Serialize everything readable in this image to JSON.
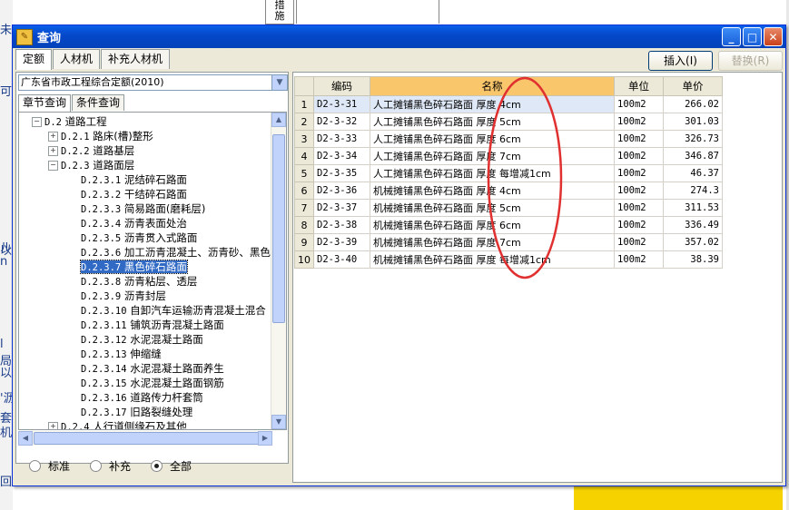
{
  "background": {
    "left_fragments": [
      "未",
      "可",
      "以",
      "ルn",
      "l局",
      "以",
      "'沥",
      "套",
      "机",
      "回"
    ],
    "top_cell_text": "措\n施"
  },
  "dialog": {
    "title": "查询",
    "title_icon": "query-icon",
    "window_buttons": {
      "minimize": "_",
      "maximize": "□",
      "close": "✕"
    },
    "tabs": [
      "定额",
      "人材机",
      "补充人材机"
    ],
    "active_tab": "定额",
    "insert_button": "插入(I)",
    "replace_button": "替换(R)"
  },
  "left": {
    "quota_book": "广东省市政工程综合定额(2010)",
    "subtabs": [
      "章节查询",
      "条件查询"
    ],
    "tree": [
      {
        "level": 0,
        "toggle": "−",
        "code": "D.2",
        "label": "道路工程"
      },
      {
        "level": 1,
        "toggle": "+",
        "code": "D.2.1",
        "label": "路床(槽)整形"
      },
      {
        "level": 1,
        "toggle": "+",
        "code": "D.2.2",
        "label": "道路基层"
      },
      {
        "level": 1,
        "toggle": "−",
        "code": "D.2.3",
        "label": "道路面层"
      },
      {
        "level": 2,
        "code": "D.2.3.1",
        "label": "泥结碎石路面"
      },
      {
        "level": 2,
        "code": "D.2.3.2",
        "label": "干结碎石路面"
      },
      {
        "level": 2,
        "code": "D.2.3.3",
        "label": "简易路面(磨耗层)"
      },
      {
        "level": 2,
        "code": "D.2.3.4",
        "label": "沥青表面处治"
      },
      {
        "level": 2,
        "code": "D.2.3.5",
        "label": "沥青贯入式路面"
      },
      {
        "level": 2,
        "code": "D.2.3.6",
        "label": "加工沥青混凝土、沥青砂、黑色"
      },
      {
        "level": 2,
        "code": "D.2.3.7",
        "label": "黑色碎石路面",
        "selected": true
      },
      {
        "level": 2,
        "code": "D.2.3.8",
        "label": "沥青粘层、透层"
      },
      {
        "level": 2,
        "code": "D.2.3.9",
        "label": "沥青封层"
      },
      {
        "level": 2,
        "code": "D.2.3.10",
        "label": "自卸汽车运输沥青混凝土混合"
      },
      {
        "level": 2,
        "code": "D.2.3.11",
        "label": "铺筑沥青混凝土路面"
      },
      {
        "level": 2,
        "code": "D.2.3.12",
        "label": "水泥混凝土路面"
      },
      {
        "level": 2,
        "code": "D.2.3.13",
        "label": "伸缩缝"
      },
      {
        "level": 2,
        "code": "D.2.3.14",
        "label": "水泥混凝土路面养生"
      },
      {
        "level": 2,
        "code": "D.2.3.15",
        "label": "水泥混凝土路面钢筋"
      },
      {
        "level": 2,
        "code": "D.2.3.16",
        "label": "道路传力杆套筒"
      },
      {
        "level": 2,
        "code": "D.2.3.17",
        "label": "旧路裂缝处理"
      },
      {
        "level": 1,
        "toggle": "+",
        "code": "D.2.4",
        "label": "人行道侧缘石及其他"
      }
    ],
    "filters": [
      {
        "label": "标准",
        "checked": false
      },
      {
        "label": "补充",
        "checked": false
      },
      {
        "label": "全部",
        "checked": true
      }
    ]
  },
  "grid": {
    "columns": [
      "",
      "编码",
      "名称",
      "单位",
      "单价"
    ],
    "rows": [
      {
        "no": "1",
        "code": "D2-3-31",
        "name": "人工摊铺黑色碎石路面 厚度 4cm",
        "unit": "100m2",
        "price": "266.02"
      },
      {
        "no": "2",
        "code": "D2-3-32",
        "name": "人工摊铺黑色碎石路面 厚度 5cm",
        "unit": "100m2",
        "price": "301.03"
      },
      {
        "no": "3",
        "code": "D2-3-33",
        "name": "人工摊铺黑色碎石路面 厚度 6cm",
        "unit": "100m2",
        "price": "326.73"
      },
      {
        "no": "4",
        "code": "D2-3-34",
        "name": "人工摊铺黑色碎石路面 厚度 7cm",
        "unit": "100m2",
        "price": "346.87"
      },
      {
        "no": "5",
        "code": "D2-3-35",
        "name": "人工摊铺黑色碎石路面 厚度 每增减1cm",
        "unit": "100m2",
        "price": "46.37"
      },
      {
        "no": "6",
        "code": "D2-3-36",
        "name": "机械摊铺黑色碎石路面 厚度 4cm",
        "unit": "100m2",
        "price": "274.3"
      },
      {
        "no": "7",
        "code": "D2-3-37",
        "name": "机械摊铺黑色碎石路面 厚度 5cm",
        "unit": "100m2",
        "price": "311.53"
      },
      {
        "no": "8",
        "code": "D2-3-38",
        "name": "机械摊铺黑色碎石路面 厚度 6cm",
        "unit": "100m2",
        "price": "336.49"
      },
      {
        "no": "9",
        "code": "D2-3-39",
        "name": "机械摊铺黑色碎石路面 厚度 7cm",
        "unit": "100m2",
        "price": "357.02"
      },
      {
        "no": "10",
        "code": "D2-3-40",
        "name": "机械摊铺黑色碎石路面 厚度 每增减1cm",
        "unit": "100m2",
        "price": "38.39"
      }
    ]
  },
  "annotation": {
    "color": "#e03030"
  }
}
